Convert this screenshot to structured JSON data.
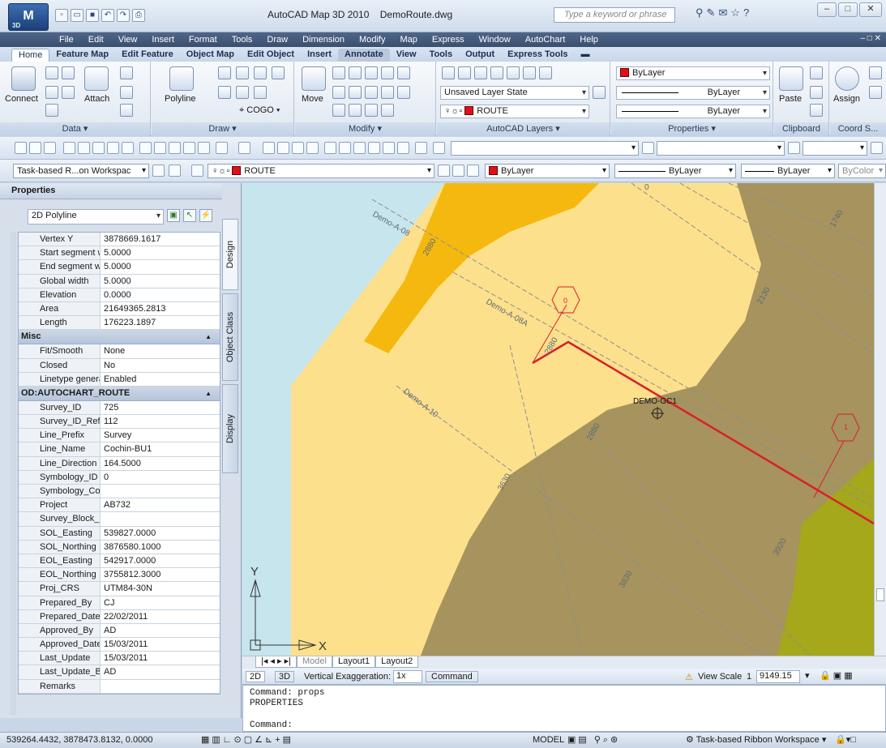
{
  "window": {
    "title": "AutoCAD Map 3D 2010",
    "document": "DemoRoute.dwg",
    "search_placeholder": "Type a keyword or phrase",
    "app_badge": "3D"
  },
  "menu": [
    "File",
    "Edit",
    "View",
    "Insert",
    "Format",
    "Tools",
    "Draw",
    "Dimension",
    "Modify",
    "Map",
    "Express",
    "Window",
    "AutoChart",
    "Help"
  ],
  "ribbon_tabs": [
    "Home",
    "Feature Map",
    "Edit Feature",
    "Object Map",
    "Edit Object",
    "Insert",
    "Annotate",
    "View",
    "Tools",
    "Output",
    "Express Tools"
  ],
  "ribbon": {
    "panels": [
      "Data ▾",
      "Draw ▾",
      "Modify ▾",
      "AutoCAD Layers ▾",
      "Properties ▾",
      "Clipboard",
      "Coord S..."
    ],
    "buttons": {
      "connect": "Connect",
      "attach": "Attach",
      "polyline": "Polyline",
      "cogo": "COGO",
      "move": "Move",
      "paste": "Paste",
      "assign": "Assign"
    },
    "layer_state": "Unsaved Layer State",
    "layer": "ROUTE",
    "color": "ByLayer",
    "linetype": "ByLayer",
    "lineweight": "ByLayer"
  },
  "toolbar2": {
    "workspace": "Task-based R...on Workspac",
    "layer": "ROUTE",
    "color": "ByLayer",
    "linetype": "ByLayer",
    "lineweight": "ByLayer",
    "plotstyle": "ByColor"
  },
  "properties": {
    "title": "Properties",
    "object_type": "2D Polyline",
    "vertical_tabs": [
      "Design",
      "Object Class",
      "Display"
    ],
    "geometry_rows": [
      {
        "k": "Vertex Y",
        "v": "3878669.1617"
      },
      {
        "k": "Start segment wi...",
        "v": "5.0000"
      },
      {
        "k": "End segment width",
        "v": "5.0000"
      },
      {
        "k": "Global width",
        "v": "5.0000"
      },
      {
        "k": "Elevation",
        "v": "0.0000"
      },
      {
        "k": "Area",
        "v": "21649365.2813"
      },
      {
        "k": "Length",
        "v": "176223.1897"
      }
    ],
    "misc_title": "Misc",
    "misc_rows": [
      {
        "k": "Fit/Smooth",
        "v": "None"
      },
      {
        "k": "Closed",
        "v": "No"
      },
      {
        "k": "Linetype generati...",
        "v": "Enabled"
      }
    ],
    "od_title": "OD:AUTOCHART_ROUTE",
    "od_rows": [
      {
        "k": "Survey_ID",
        "v": "725"
      },
      {
        "k": "Survey_ID_Ref",
        "v": "112"
      },
      {
        "k": "Line_Prefix",
        "v": "Survey"
      },
      {
        "k": "Line_Name",
        "v": "Cochin-BU1"
      },
      {
        "k": "Line_Direction",
        "v": "164.5000"
      },
      {
        "k": "Symbology_ID",
        "v": "0"
      },
      {
        "k": "Symbology_Code",
        "v": ""
      },
      {
        "k": "Project",
        "v": "AB732"
      },
      {
        "k": "Survey_Block_Na...",
        "v": ""
      },
      {
        "k": "SOL_Easting",
        "v": "539827.0000"
      },
      {
        "k": "SOL_Northing",
        "v": "3876580.1000"
      },
      {
        "k": "EOL_Easting",
        "v": "542917.0000"
      },
      {
        "k": "EOL_Northing",
        "v": "3755812.3000"
      },
      {
        "k": "Proj_CRS",
        "v": "UTM84-30N"
      },
      {
        "k": "Prepared_By",
        "v": "CJ"
      },
      {
        "k": "Prepared_Date",
        "v": "22/02/2011"
      },
      {
        "k": "Approved_By",
        "v": "AD"
      },
      {
        "k": "Approved_Date",
        "v": "15/03/2011"
      },
      {
        "k": "Last_Update",
        "v": "15/03/2011"
      },
      {
        "k": "Last_Update_By",
        "v": "AD"
      },
      {
        "k": "Remarks",
        "v": ""
      }
    ]
  },
  "drawing": {
    "labels": {
      "a08": "Demo-A-08",
      "a08a": "Demo-A-08A",
      "a10": "Demo-A-10",
      "gc1": "DEMO-GC1",
      "d2880": "2880",
      "d2880b": "2880",
      "d2880c": "2880",
      "d2130": "2130",
      "d1740": "1740",
      "d3630": "3630",
      "d3830": "3830",
      "d3920": "3920",
      "d0": "0",
      "d1": "1",
      "d0b": "0"
    },
    "ucs_x": "X",
    "ucs_y": "Y",
    "colors": {
      "water": "#c7e5ec",
      "sand": "#fde08c",
      "orange": "#f5b80f",
      "mud": "#a6935e",
      "olive": "#a4a81a",
      "route": "#d9202a"
    }
  },
  "layout_tabs": [
    "Model",
    "Layout1",
    "Layout2"
  ],
  "status2": {
    "d2": "2D",
    "d3": "3D",
    "vex": "Vertical Exaggeration:",
    "vex_val": "1x",
    "command": "Command",
    "view_scale": "View Scale",
    "scale_a": "1",
    "scale_b": "9149.15"
  },
  "command_lines": [
    "Command: props",
    "PROPERTIES",
    "Command:"
  ],
  "statusbar": {
    "coords": "539264.4432, 3878473.8132, 0.0000",
    "model": "MODEL",
    "workspace": "Task-based Ribbon Workspace"
  }
}
